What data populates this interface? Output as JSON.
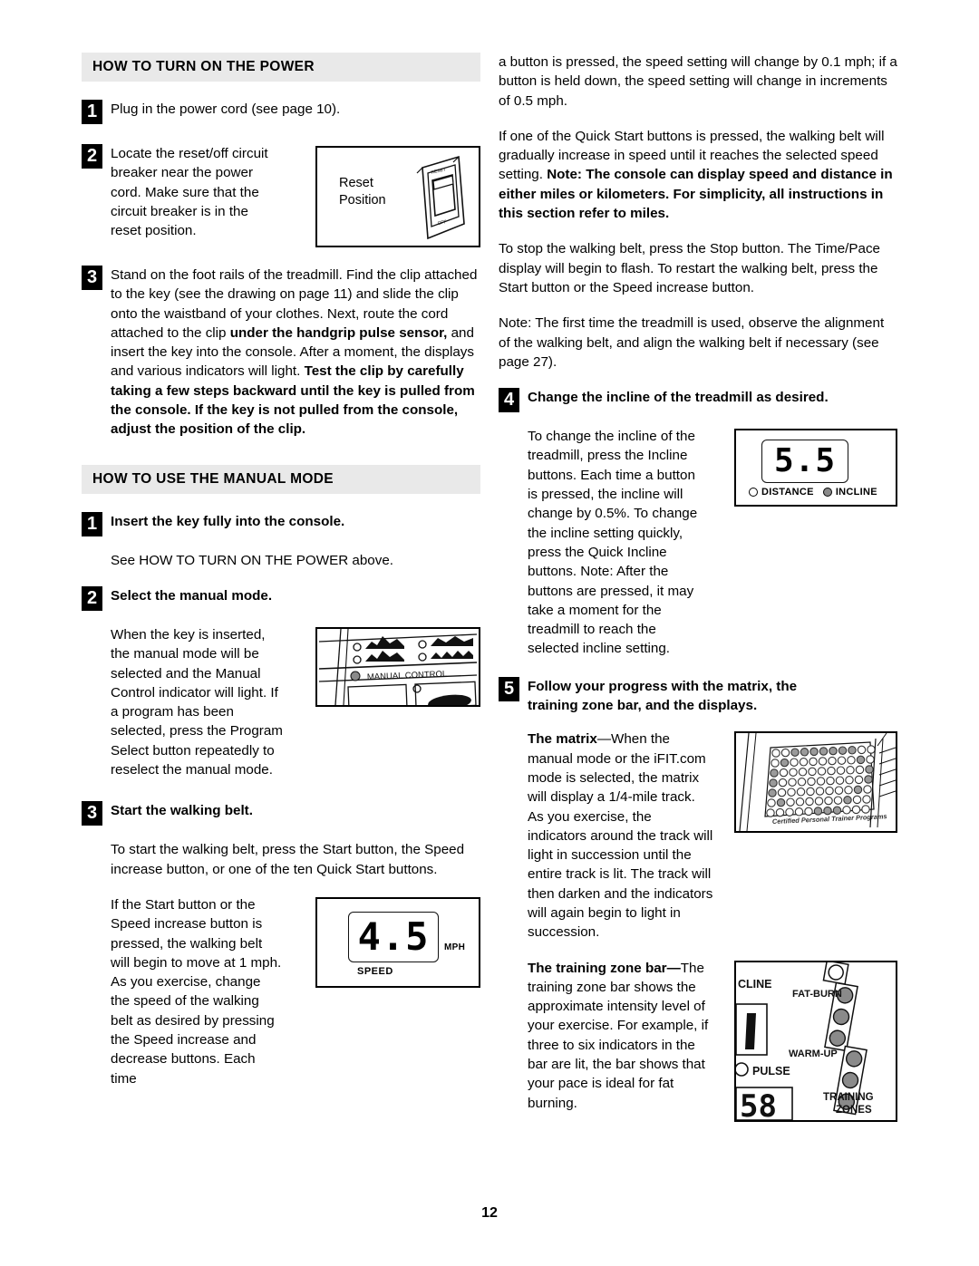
{
  "page": {
    "number": "12"
  },
  "left_column": {
    "section1": {
      "heading": "HOW TO TURN ON THE POWER",
      "steps": [
        {
          "num": "1",
          "text": "Plug in the power cord (see page 10)."
        },
        {
          "num": "2",
          "text": "Locate the reset/off circuit breaker near the power cord. Make sure that the circuit breaker is in the reset position."
        },
        {
          "num": "3",
          "text_plain_1": "Stand on the foot rails of the treadmill. Find the clip attached to the key (see the drawing on page 11) and slide the clip onto the waistband of your clothes. Next, route the cord attached to the clip ",
          "text_bold_1": "under the handgrip pulse sensor,",
          "text_plain_2": " and insert the key into the console. After a moment, the displays and various indicators will light. ",
          "text_bold_2": "Test the clip by carefully taking a few steps backward until the key is pulled from the console. If the key is not pulled from the console, adjust the position of the clip."
        }
      ],
      "breaker_figure": {
        "label_line1": "Reset",
        "label_line2": "Position",
        "switch_top_label": "RESET",
        "switch_bottom_label": "OFF"
      }
    },
    "section2": {
      "heading": "HOW TO USE THE MANUAL MODE",
      "step1": {
        "num": "1",
        "title": "Insert the key fully into the console.",
        "body": "See HOW TO TURN ON THE POWER above."
      },
      "step2": {
        "num": "2",
        "title": "Select the manual mode.",
        "body": "When the key is inserted, the manual mode will be selected and the Manual Control indicator will light. If a program has been selected, press the Program Select button repeatedly to reselect the manual mode."
      },
      "console_figure": {
        "label": "MANUAL CONTROL"
      },
      "step3": {
        "num": "3",
        "title": "Start the walking belt.",
        "body1": "To start the walking belt, press the Start button, the Speed increase button, or one of the ten Quick Start buttons.",
        "body2": "If the Start button or the Speed increase button is pressed, the walking belt will begin to move at 1 mph. As you exercise, change the speed of the walking belt as desired by pressing the Speed increase and decrease buttons. Each time"
      },
      "speed_display": {
        "value": "4.5",
        "unit": "MPH",
        "caption": "SPEED"
      }
    }
  },
  "right_column": {
    "para1": "a button is pressed, the speed setting will change by 0.1 mph; if a button is held down, the speed setting will change in increments of 0.5 mph.",
    "para2_plain": "If one of the Quick Start buttons is pressed, the walking belt will gradually increase in speed until it reaches the selected speed setting. ",
    "para2_bold": "Note: The console can display speed and distance in either miles or kilometers. For simplicity, all instructions in this section refer to miles.",
    "para3": "To stop the walking belt, press the Stop button. The Time/Pace display will begin to flash. To restart the walking belt, press the Start button or the Speed increase button.",
    "para4": "Note: The first time the treadmill is used, observe the alignment of the walking belt, and align the walking belt if necessary (see page 27).",
    "step4": {
      "num": "4",
      "title": "Change the incline of the treadmill as desired.",
      "body": "To change the incline of the treadmill, press the Incline buttons. Each time a button is pressed, the incline will change by 0.5%. To change the incline setting quickly, press the Quick Incline buttons. Note: After the buttons are pressed, it may take a moment for the treadmill to reach the selected incline setting."
    },
    "incline_display": {
      "value": "5.5",
      "indicator_distance": "DISTANCE",
      "indicator_incline": "INCLINE",
      "distance_lit": false,
      "incline_lit": true
    },
    "step5": {
      "num": "5",
      "title": "Follow your progress with the matrix, the training zone bar, and the displays.",
      "matrix_bold": "The matrix",
      "matrix_text": "—When the manual mode or the iFIT.com mode is selected, the matrix will display a 1/4-mile track. As you exercise, the indicators around the track will light in succession until the entire track is lit. The track will then darken and the indicators will again begin to light in succession.",
      "zone_bold": "The training zone bar—",
      "zone_text": "The training zone bar shows the approximate intensity level of your exercise. For example, if three to six indicators in the bar are lit, the bar shows that your pace is ideal for fat burning."
    },
    "matrix_figure": {
      "caption": "Certified Personal Trainer Programs",
      "rows": 7,
      "cols": 11
    },
    "zone_figure": {
      "label_incline": "CLINE",
      "label_fatburn": "FAT-BURN",
      "label_pulse": "PULSE",
      "label_warmup": "WARM-UP",
      "label_training_line1": "TRAINING",
      "label_training_line2": "ZONES",
      "digits": "58"
    }
  }
}
